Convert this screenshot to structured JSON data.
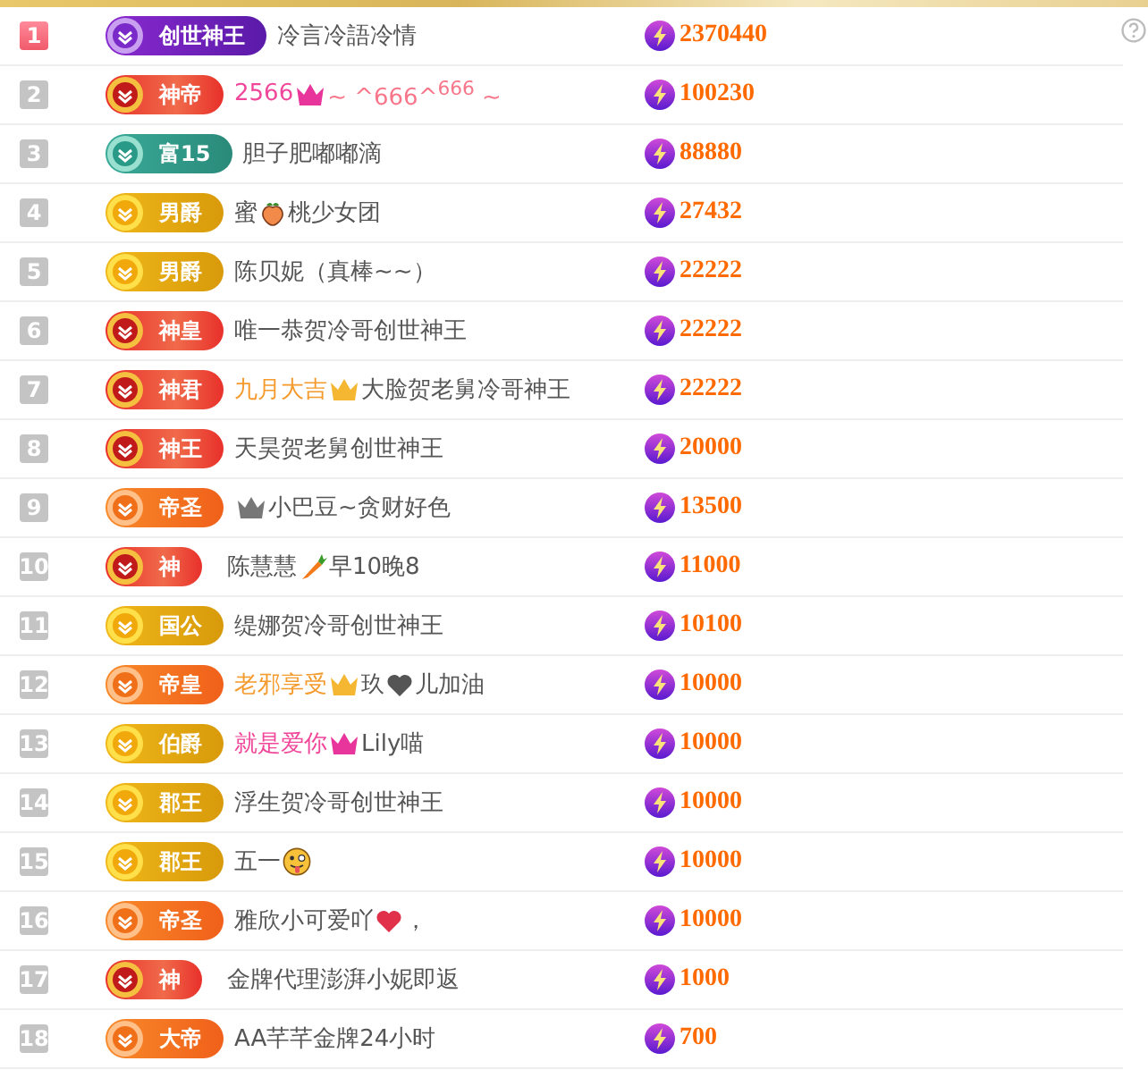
{
  "rows": [
    {
      "rank": "1",
      "highlighted": true,
      "badge": {
        "label": "创世神王",
        "kind": "purple"
      },
      "name": [
        {
          "kind": "text",
          "text": "冷言冷語冷情"
        }
      ],
      "score": "2370440"
    },
    {
      "rank": "2",
      "highlighted": false,
      "badge": {
        "label": "神帝",
        "kind": "red"
      },
      "name": [
        {
          "kind": "text",
          "text": "2566",
          "color": "#f0479a"
        },
        {
          "kind": "crown",
          "color": "#e8359b"
        },
        {
          "kind": "text",
          "text": "~ ^666^$^{666}$ ~",
          "color": "#f7768a"
        }
      ],
      "score": "100230"
    },
    {
      "rank": "3",
      "highlighted": false,
      "badge": {
        "label": "富15",
        "kind": "teal"
      },
      "name": [
        {
          "kind": "text",
          "text": "胆子肥嘟嘟滴"
        }
      ],
      "score": "88880"
    },
    {
      "rank": "4",
      "highlighted": false,
      "badge": {
        "label": "男爵",
        "kind": "gold"
      },
      "name": [
        {
          "kind": "text",
          "text": "蜜"
        },
        {
          "kind": "peach"
        },
        {
          "kind": "text",
          "text": "桃少女团"
        }
      ],
      "score": "27432"
    },
    {
      "rank": "5",
      "highlighted": false,
      "badge": {
        "label": "男爵",
        "kind": "gold"
      },
      "name": [
        {
          "kind": "text",
          "text": "陈贝妮（真棒~~）"
        }
      ],
      "score": "22222"
    },
    {
      "rank": "6",
      "highlighted": false,
      "badge": {
        "label": "神皇",
        "kind": "red"
      },
      "name": [
        {
          "kind": "text",
          "text": "唯一恭贺冷哥创世神王"
        }
      ],
      "score": "22222"
    },
    {
      "rank": "7",
      "highlighted": false,
      "badge": {
        "label": "神君",
        "kind": "red"
      },
      "name": [
        {
          "kind": "text",
          "text": "九月大吉",
          "color": "#f59a2c"
        },
        {
          "kind": "crown",
          "color": "#f5b731"
        },
        {
          "kind": "text",
          "text": "大脸贺老舅冷哥神王"
        }
      ],
      "score": "22222"
    },
    {
      "rank": "8",
      "highlighted": false,
      "badge": {
        "label": "神王",
        "kind": "red"
      },
      "name": [
        {
          "kind": "text",
          "text": "天昊贺老舅创世神王"
        }
      ],
      "score": "20000"
    },
    {
      "rank": "9",
      "highlighted": false,
      "badge": {
        "label": "帝圣",
        "kind": "orange"
      },
      "name": [
        {
          "kind": "crown",
          "color": "#777777"
        },
        {
          "kind": "text",
          "text": "小巴豆~贪财好色"
        }
      ],
      "score": "13500"
    },
    {
      "rank": "10",
      "highlighted": false,
      "badge": {
        "label": "神",
        "kind": "red"
      },
      "name": [
        {
          "kind": "text",
          "text": "陈慧慧"
        },
        {
          "kind": "carrot"
        },
        {
          "kind": "text",
          "text": "早10晚8"
        }
      ],
      "score": "11000"
    },
    {
      "rank": "11",
      "highlighted": false,
      "badge": {
        "label": "国公",
        "kind": "gold"
      },
      "name": [
        {
          "kind": "text",
          "text": "缇娜贺冷哥创世神王"
        }
      ],
      "score": "10100"
    },
    {
      "rank": "12",
      "highlighted": false,
      "badge": {
        "label": "帝皇",
        "kind": "orange"
      },
      "name": [
        {
          "kind": "text",
          "text": "老邪享受",
          "color": "#f59a2c"
        },
        {
          "kind": "crown",
          "color": "#f5b731"
        },
        {
          "kind": "text",
          "text": "玖"
        },
        {
          "kind": "heart",
          "color": "#555555"
        },
        {
          "kind": "text",
          "text": "儿加油"
        }
      ],
      "score": "10000"
    },
    {
      "rank": "13",
      "highlighted": false,
      "badge": {
        "label": "伯爵",
        "kind": "gold"
      },
      "name": [
        {
          "kind": "text",
          "text": "就是爱你",
          "color": "#f0479a"
        },
        {
          "kind": "crown",
          "color": "#e8359b"
        },
        {
          "kind": "text",
          "text": "Lily喵"
        }
      ],
      "score": "10000"
    },
    {
      "rank": "14",
      "highlighted": false,
      "badge": {
        "label": "郡王",
        "kind": "gold"
      },
      "name": [
        {
          "kind": "text",
          "text": "浮生贺冷哥创世神王"
        }
      ],
      "score": "10000"
    },
    {
      "rank": "15",
      "highlighted": false,
      "badge": {
        "label": "郡王",
        "kind": "gold"
      },
      "name": [
        {
          "kind": "text",
          "text": "五一"
        },
        {
          "kind": "face"
        }
      ],
      "score": "10000"
    },
    {
      "rank": "16",
      "highlighted": false,
      "badge": {
        "label": "帝圣",
        "kind": "orange"
      },
      "name": [
        {
          "kind": "text",
          "text": "雅欣小可爱吖"
        },
        {
          "kind": "heart",
          "color": "#e0304a"
        },
        {
          "kind": "text",
          "text": "，"
        }
      ],
      "score": "10000"
    },
    {
      "rank": "17",
      "highlighted": false,
      "badge": {
        "label": "神",
        "kind": "red"
      },
      "name": [
        {
          "kind": "text",
          "text": "金牌代理澎湃小妮即返"
        }
      ],
      "score": "1000"
    },
    {
      "rank": "18",
      "highlighted": false,
      "badge": {
        "label": "大帝",
        "kind": "orange"
      },
      "name": [
        {
          "kind": "text",
          "text": "AA芊芊金牌24小时"
        }
      ],
      "score": "700"
    }
  ]
}
